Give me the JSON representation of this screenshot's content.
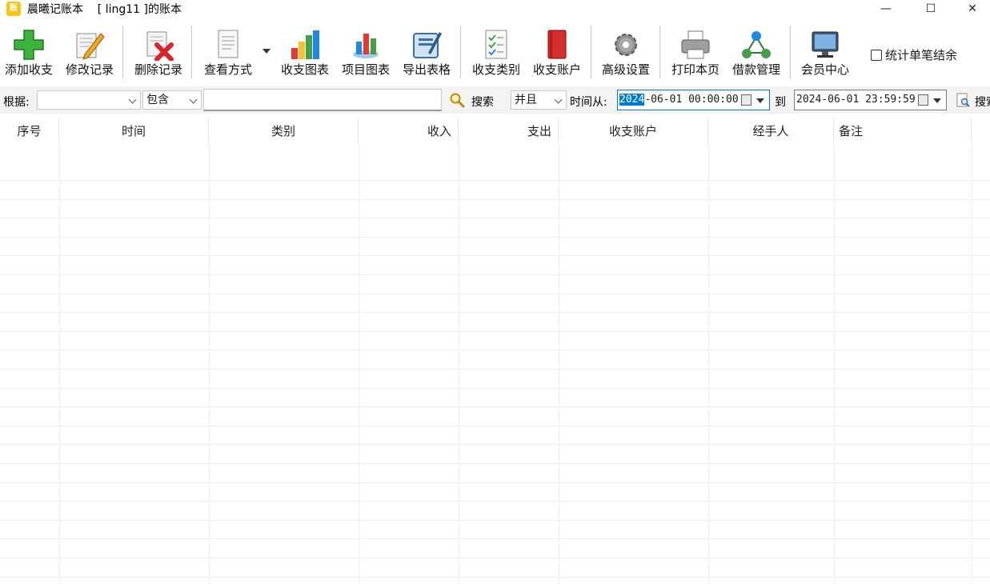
{
  "titlebar": {
    "icon_text": "账",
    "title": "晨曦记账本    [ ling11 ]的账本",
    "minimize": "—",
    "maximize": "☐",
    "close": "✕"
  },
  "toolbar": {
    "add": "添加收支",
    "edit": "修改记录",
    "delete": "删除记录",
    "view": "查看方式",
    "chart_income": "收支图表",
    "chart_project": "项目图表",
    "export": "导出表格",
    "categories": "收支类别",
    "accounts": "收支账户",
    "advanced": "高级设置",
    "print": "打印本页",
    "loans": "借款管理",
    "member": "会员中心",
    "checkbox_label": "统计单笔结余"
  },
  "filter": {
    "basis_label": "根据:",
    "basis_value": "",
    "match_value": "包含",
    "keyword_value": "",
    "search_label": "搜索",
    "logic_value": "并且",
    "time_from_label": "时间从:",
    "date_from_sel": "2024",
    "date_from_rest": "-06-01 00:00:00",
    "to_label": "到",
    "date_to": "2024-06-01 23:59:59",
    "search2_label": "搜索"
  },
  "table": {
    "columns": [
      "序号",
      "时间",
      "类别",
      "收入",
      "支出",
      "收支账户",
      "经手人",
      "备注"
    ]
  },
  "colors": {
    "accent": "#0078d7",
    "grid": "#eeeeee"
  }
}
